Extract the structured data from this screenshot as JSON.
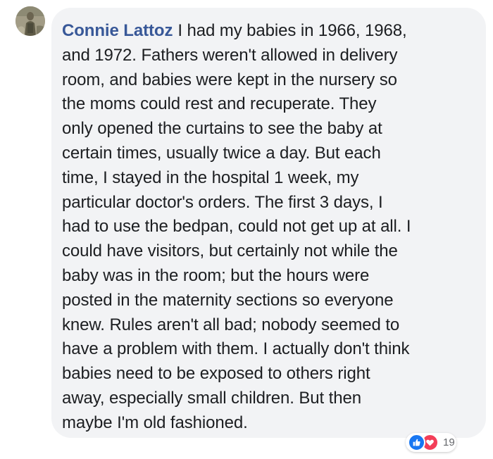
{
  "comment": {
    "author": "Connie Lattoz",
    "lines": [
      "I had my babies in 1966, 1968,",
      "and 1972. Fathers weren't allowed in delivery",
      "room, and babies were kept in the nursery so",
      "the moms could rest and recuperate. They",
      "only opened the curtains to see the baby at",
      "certain times, usually twice a day. But each",
      "time, I stayed in the hospital 1 week, my",
      "particular doctor's orders. The first 3 days, I",
      "had to use the bedpan, could not get up at all. I",
      "could have visitors, but certainly not while the",
      "baby was in the room; but the hours were",
      "posted in the maternity sections so everyone",
      "knew. Rules aren't all bad; nobody seemed to",
      "have a problem with them. I actually don't think",
      "babies need to be exposed to others right",
      "away, especially small children. But then",
      "maybe I'm old fashioned."
    ]
  },
  "reactions": {
    "icons": [
      "like-icon",
      "love-icon"
    ],
    "count": "19",
    "colors": {
      "like": "#1877f2",
      "love": "#f33e58"
    }
  },
  "colors": {
    "author": "#385898",
    "text": "#1c1e21",
    "bubble": "#f2f3f5"
  }
}
